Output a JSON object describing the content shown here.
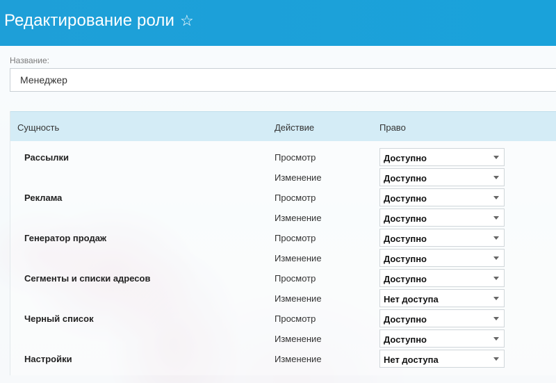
{
  "header": {
    "title": "Редактирование роли",
    "star_glyph": "☆"
  },
  "name_field": {
    "label": "Название:",
    "value": "Менеджер"
  },
  "table": {
    "columns": {
      "entity": "Сущность",
      "action": "Действие",
      "right": "Право"
    },
    "entities": [
      {
        "name": "Рассылки",
        "rows": [
          {
            "action": "Просмотр",
            "right": "Доступно"
          },
          {
            "action": "Изменение",
            "right": "Доступно"
          }
        ]
      },
      {
        "name": "Реклама",
        "rows": [
          {
            "action": "Просмотр",
            "right": "Доступно"
          },
          {
            "action": "Изменение",
            "right": "Доступно"
          }
        ]
      },
      {
        "name": "Генератор продаж",
        "rows": [
          {
            "action": "Просмотр",
            "right": "Доступно"
          },
          {
            "action": "Изменение",
            "right": "Доступно"
          }
        ]
      },
      {
        "name": "Сегменты и списки адресов",
        "rows": [
          {
            "action": "Просмотр",
            "right": "Доступно"
          },
          {
            "action": "Изменение",
            "right": "Нет доступа"
          }
        ]
      },
      {
        "name": "Черный список",
        "rows": [
          {
            "action": "Просмотр",
            "right": "Доступно"
          },
          {
            "action": "Изменение",
            "right": "Доступно"
          }
        ]
      },
      {
        "name": "Настройки",
        "rows": [
          {
            "action": "Изменение",
            "right": "Нет доступа"
          }
        ]
      }
    ]
  },
  "colors": {
    "header_bg": "#1e9fd8",
    "table_head_bg": "#d4ecf6"
  }
}
